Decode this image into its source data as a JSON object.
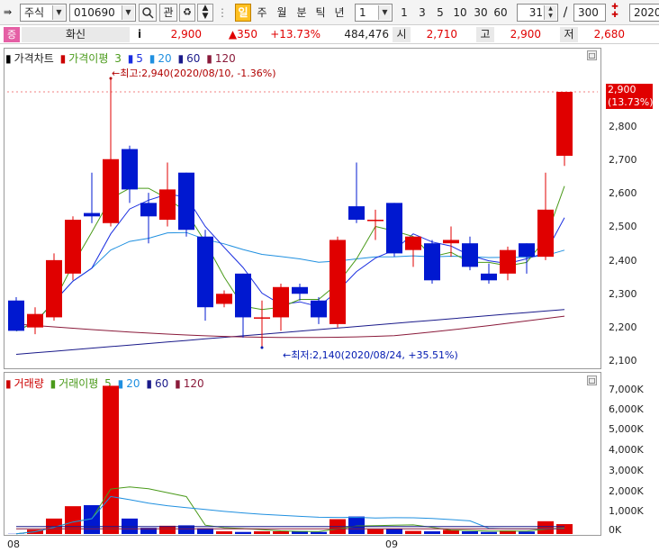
{
  "toolbar": {
    "market_select": "주식",
    "code": "010690",
    "search_icon": "magnifier-icon",
    "gwan": "관",
    "day": "일",
    "week": "주",
    "month": "월",
    "minute": "분",
    "tick": "틱",
    "year": "년",
    "interval_select": "1",
    "intervals": [
      "1",
      "3",
      "5",
      "10",
      "30",
      "60"
    ],
    "count_value": "31",
    "slash": "/",
    "total_value": "300",
    "date_value": "2020/"
  },
  "info": {
    "badge": "증",
    "name": "화신",
    "info_icon": "i",
    "price": "2,900",
    "change": "▲350",
    "change_pct": "+13.73%",
    "volume": "484,476",
    "open_label": "시",
    "open": "2,710",
    "high_label": "고",
    "high": "2,900",
    "low_label": "저",
    "low": "2,680"
  },
  "price_panel": {
    "legend_title": "가격차트",
    "legend_ma_label": "가격이평",
    "legend_ma_periods": [
      "3",
      "5",
      "20",
      "60",
      "120"
    ],
    "legend_colors": [
      "#4a9a1a",
      "#1a2ee0",
      "#2090e0",
      "#1a1a8a",
      "#8a1a3a"
    ],
    "high_annotation": "←최고:2,940(2020/08/10, -1.36%)",
    "low_annotation": "←최저:2,140(2020/08/24, +35.51%)",
    "current_price_tag": "2,900",
    "current_pct_tag": "(13.73%)",
    "y_ticks": [
      "2,800",
      "2,700",
      "2,600",
      "2,500",
      "2,400",
      "2,300",
      "2,200",
      "2,100"
    ]
  },
  "volume_panel": {
    "legend_title": "거래량",
    "legend_ma_label": "거래이평",
    "legend_ma_periods": [
      "5",
      "20",
      "60",
      "120"
    ],
    "y_ticks": [
      "7,000K",
      "6,000K",
      "5,000K",
      "4,000K",
      "3,000K",
      "2,000K",
      "1,000K",
      "0K"
    ]
  },
  "x_axis": {
    "labels": [
      "08",
      "09"
    ]
  },
  "chart_data": {
    "type": "candlestick",
    "series_up_color": "#e00000",
    "series_down_color": "#0018d0",
    "candles": [
      {
        "o": 2280,
        "h": 2290,
        "l": 2190,
        "c": 2190
      },
      {
        "o": 2200,
        "h": 2260,
        "l": 2180,
        "c": 2240
      },
      {
        "o": 2230,
        "h": 2420,
        "l": 2220,
        "c": 2400
      },
      {
        "o": 2360,
        "h": 2530,
        "l": 2340,
        "c": 2520
      },
      {
        "o": 2540,
        "h": 2660,
        "l": 2510,
        "c": 2530
      },
      {
        "o": 2510,
        "h": 2940,
        "l": 2500,
        "c": 2700
      },
      {
        "o": 2730,
        "h": 2740,
        "l": 2570,
        "c": 2610
      },
      {
        "o": 2570,
        "h": 2600,
        "l": 2450,
        "c": 2530
      },
      {
        "o": 2520,
        "h": 2690,
        "l": 2500,
        "c": 2610
      },
      {
        "o": 2660,
        "h": 2660,
        "l": 2470,
        "c": 2490
      },
      {
        "o": 2470,
        "h": 2490,
        "l": 2220,
        "c": 2260
      },
      {
        "o": 2270,
        "h": 2310,
        "l": 2260,
        "c": 2300
      },
      {
        "o": 2360,
        "h": 2360,
        "l": 2170,
        "c": 2230
      },
      {
        "o": 2230,
        "h": 2280,
        "l": 2140,
        "c": 2230
      },
      {
        "o": 2230,
        "h": 2330,
        "l": 2190,
        "c": 2320
      },
      {
        "o": 2320,
        "h": 2330,
        "l": 2280,
        "c": 2300
      },
      {
        "o": 2280,
        "h": 2290,
        "l": 2210,
        "c": 2230
      },
      {
        "o": 2210,
        "h": 2470,
        "l": 2200,
        "c": 2460
      },
      {
        "o": 2560,
        "h": 2690,
        "l": 2510,
        "c": 2520
      },
      {
        "o": 2520,
        "h": 2550,
        "l": 2460,
        "c": 2520
      },
      {
        "o": 2570,
        "h": 2570,
        "l": 2410,
        "c": 2420
      },
      {
        "o": 2430,
        "h": 2470,
        "l": 2380,
        "c": 2470
      },
      {
        "o": 2450,
        "h": 2460,
        "l": 2330,
        "c": 2340
      },
      {
        "o": 2450,
        "h": 2500,
        "l": 2410,
        "c": 2460
      },
      {
        "o": 2450,
        "h": 2470,
        "l": 2370,
        "c": 2380
      },
      {
        "o": 2360,
        "h": 2390,
        "l": 2330,
        "c": 2340
      },
      {
        "o": 2360,
        "h": 2440,
        "l": 2340,
        "c": 2430
      },
      {
        "o": 2450,
        "h": 2450,
        "l": 2360,
        "c": 2410
      },
      {
        "o": 2410,
        "h": 2660,
        "l": 2400,
        "c": 2550
      },
      {
        "o": 2710,
        "h": 2900,
        "l": 2680,
        "c": 2900
      }
    ],
    "volume_k": [
      10,
      210,
      750,
      1350,
      1400,
      7200,
      750,
      300,
      400,
      420,
      280,
      130,
      100,
      130,
      130,
      140,
      100,
      720,
      850,
      230,
      250,
      150,
      130,
      200,
      130,
      100,
      170,
      120,
      620,
      480
    ],
    "ylim_price": [
      2100,
      2900
    ],
    "ylim_volume_k": [
      0,
      7000
    ]
  }
}
